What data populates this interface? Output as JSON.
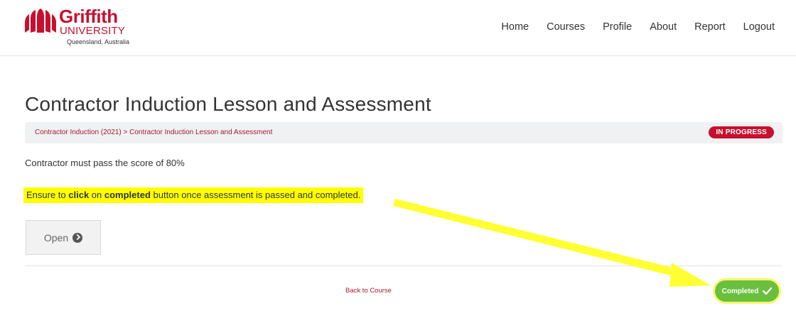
{
  "brand": {
    "name": "Griffith",
    "sub": "UNIVERSITY",
    "location": "Queensland, Australia",
    "color": "#c8102e"
  },
  "nav": {
    "items": [
      "Home",
      "Courses",
      "Profile",
      "About",
      "Report",
      "Logout"
    ]
  },
  "main": {
    "title": "Contractor Induction Lesson and Assessment",
    "breadcrumb": {
      "course": "Contractor Induction (2021)",
      "separator": " > ",
      "lesson": "Contractor Induction Lesson and Assessment"
    },
    "status": "IN PROGRESS",
    "description": "Contractor must pass the score of 80%",
    "instruction": {
      "part1": "Ensure to ",
      "click": "click",
      "part2": " on ",
      "completed": "completed",
      "part3": " button once assessment is passed and completed."
    },
    "open_label": "Open",
    "back_label": "Back to Course",
    "completed_label": "Completed"
  },
  "colors": {
    "status_badge": "#c8102e",
    "completed": "#6abf3f",
    "highlight": "#ffff00",
    "annotation_arrow": "#ffff33"
  }
}
